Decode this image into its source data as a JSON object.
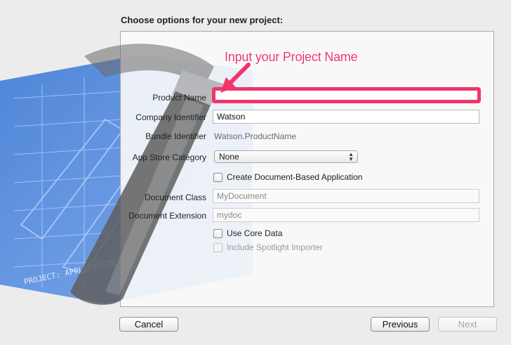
{
  "dialog": {
    "title": "Choose options for your new project:"
  },
  "annotation": {
    "text": "Input your Project Name",
    "color": "#f0356b"
  },
  "form": {
    "product_name": {
      "label": "Product Name",
      "value": ""
    },
    "company_identifier": {
      "label": "Company Identifier",
      "value": "Watson"
    },
    "bundle_identifier": {
      "label": "Bundle Identifier",
      "value": "Watson.ProductName"
    },
    "app_store_category": {
      "label": "App Store Category",
      "selected": "None"
    },
    "document_based": {
      "label": "Create Document-Based Application",
      "checked": false
    },
    "document_class": {
      "label": "Document Class",
      "placeholder": "MyDocument"
    },
    "document_extension": {
      "label": "Document Extension",
      "placeholder": "mydoc"
    },
    "core_data": {
      "label": "Use Core Data",
      "checked": false
    },
    "spotlight": {
      "label": "Include Spotlight Importer",
      "checked": false,
      "enabled": false
    }
  },
  "buttons": {
    "cancel": "Cancel",
    "previous": "Previous",
    "next": "Next"
  },
  "blueprint": {
    "caption": "PROJECT: APPLICATION . APP"
  }
}
